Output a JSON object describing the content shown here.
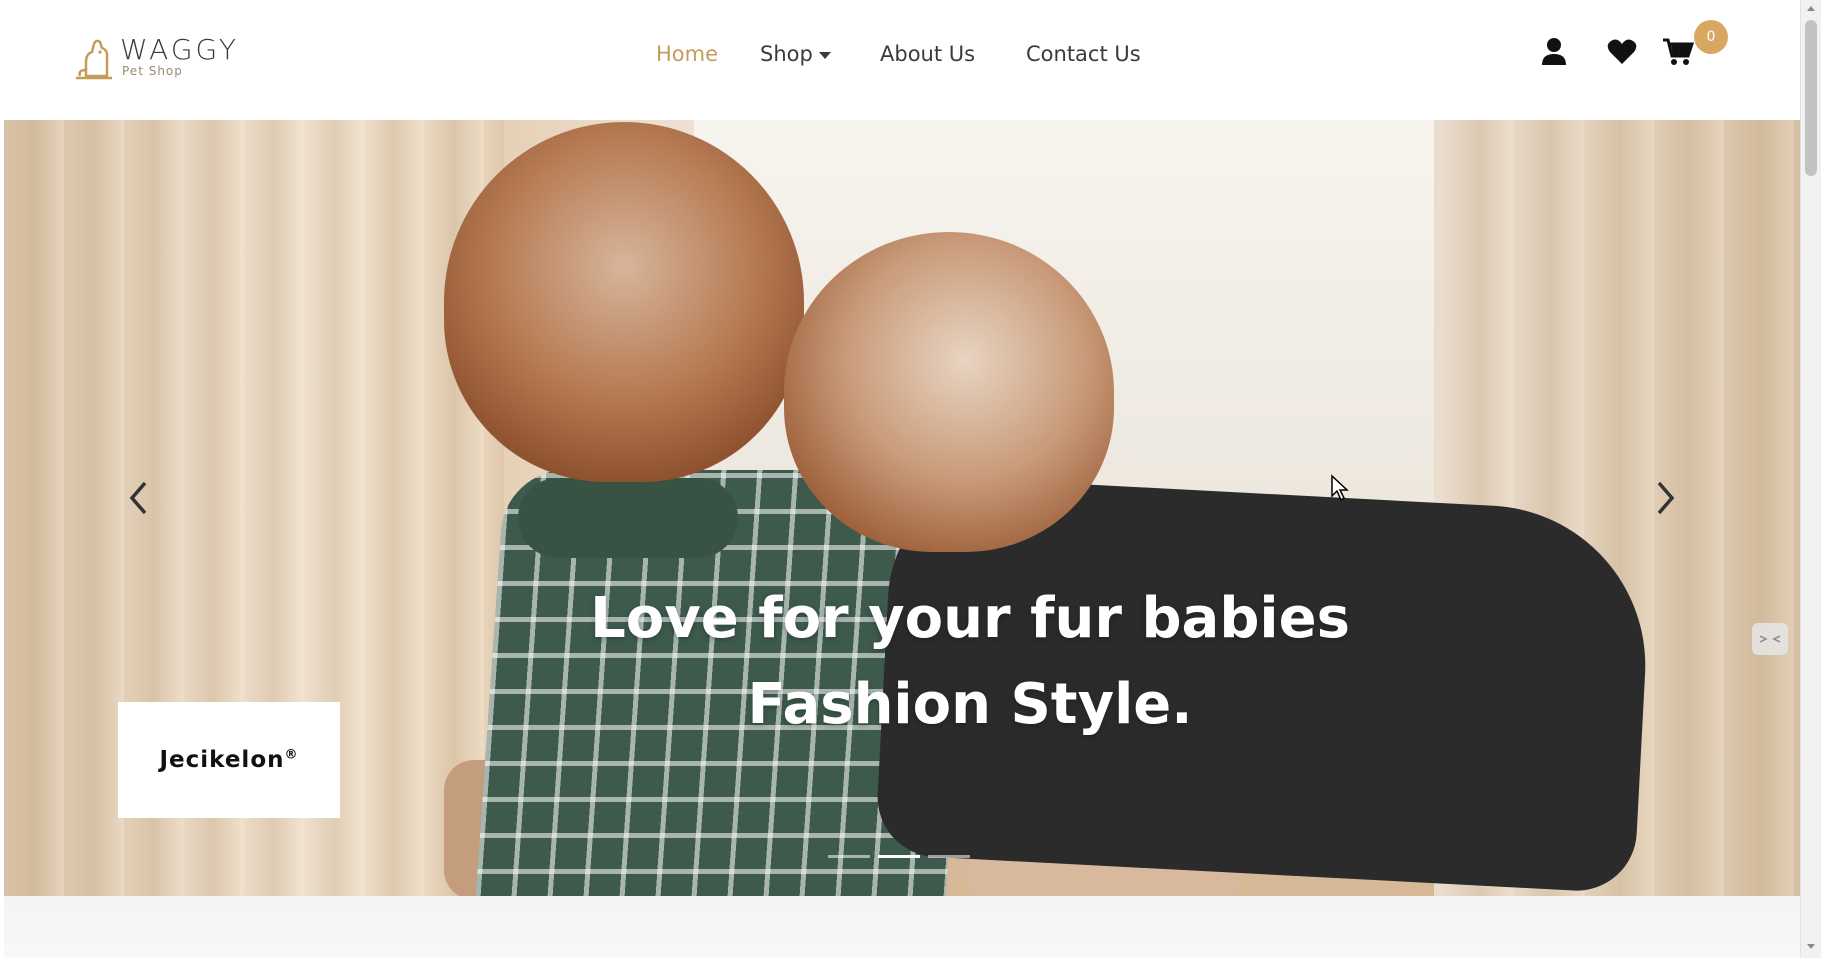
{
  "header": {
    "logo": {
      "title": "WAGGY",
      "subtitle": "Pet Shop",
      "icon": "dog-logo-icon"
    },
    "nav": [
      {
        "label": "Home",
        "active": true
      },
      {
        "label": "Shop",
        "has_dropdown": true
      },
      {
        "label": "About Us"
      },
      {
        "label": "Contact Us"
      }
    ],
    "icons": {
      "user": "user-icon",
      "wishlist": "heart-icon",
      "cart": "cart-icon"
    },
    "cart_count": "0"
  },
  "hero": {
    "title_line1": "Love for your fur babies",
    "title_line2": "Fashion Style.",
    "brand": "Jecikelon",
    "brand_mark": "®",
    "slides_total": 3,
    "active_slide": 2,
    "prev_icon": "chevron-left-icon",
    "next_icon": "chevron-right-icon"
  },
  "colors": {
    "accent": "#c69a58",
    "badge": "#d8a862",
    "nav_text": "#3b3b3b"
  }
}
